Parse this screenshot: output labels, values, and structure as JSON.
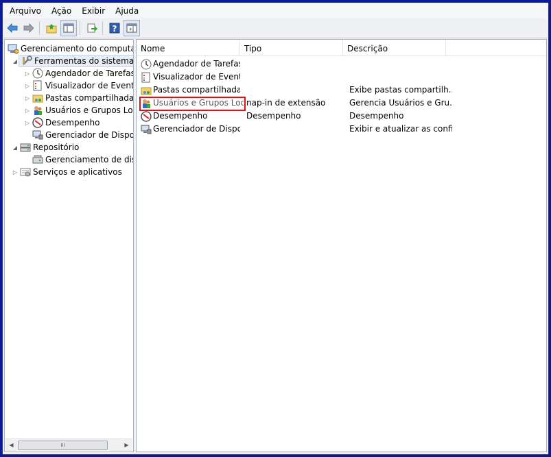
{
  "menu": [
    "Arquivo",
    "Ação",
    "Exibir",
    "Ajuda"
  ],
  "tree": {
    "root": "Gerenciamento do computador",
    "system_tools": "Ferramentas do sistema",
    "task_scheduler": "Agendador de Tarefas",
    "event_viewer": "Visualizador de Eventos",
    "shared_folders": "Pastas compartilhadas",
    "local_users": "Usuários e Grupos Loca",
    "performance": "Desempenho",
    "device_manager": "Gerenciador de Disposit",
    "storage": "Repositório",
    "disk_mgmt": "Gerenciamento de disco",
    "services": "Serviços e aplicativos"
  },
  "list": {
    "columns": [
      "Nome",
      "Tipo",
      "Descrição"
    ],
    "rows": [
      {
        "name": "Agendador de Tarefas",
        "type": "",
        "desc": "",
        "icon": "clock-icon"
      },
      {
        "name": "Visualizador de Eventos",
        "type": "",
        "desc": "",
        "icon": "event-viewer-icon"
      },
      {
        "name": "Pastas compartilhadas",
        "type": "",
        "desc": "Exibe pastas compartilh...",
        "icon": "shared-folder-icon"
      },
      {
        "name": "Usuários e Grupos Locais",
        "type": "nap-in de extensão",
        "desc": "Gerencia Usuários e Gru...",
        "icon": "users-icon"
      },
      {
        "name": "Desempenho",
        "type": "Desempenho",
        "desc": "Desempenho",
        "icon": "performance-icon"
      },
      {
        "name": "Gerenciador de Dispo...",
        "type": "",
        "desc": "Exibir e atualizar as confi...",
        "icon": "device-manager-icon"
      }
    ]
  },
  "scrollbar": {
    "grip": "III"
  },
  "colors": {
    "frame": "#0a1a9a",
    "highlight": "#e0101b"
  }
}
